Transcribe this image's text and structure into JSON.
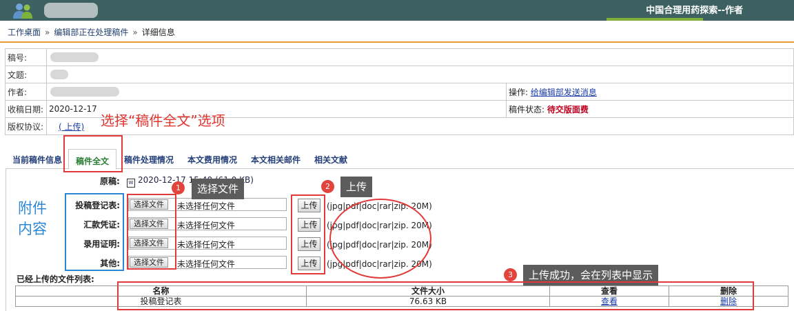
{
  "header": {
    "system_title": "中国合理用药探索--作者"
  },
  "breadcrumb": {
    "items": [
      "工作桌面",
      "编辑部正在处理稿件",
      "详细信息"
    ],
    "separator": "»"
  },
  "info": {
    "manuscript_no_label": "稿号:",
    "title_label": "文题:",
    "author_label": "作者:",
    "received_label": "收稿日期:",
    "received_value": "2020-12-17",
    "copyright_label": "版权协议:",
    "copyright_link": "( 上传)",
    "operation_label": "操作:",
    "operation_link": "给编辑部发送消息",
    "status_label": "稿件状态:",
    "status_value": "待交版面费"
  },
  "tabs": [
    "当前稿件信息",
    "稿件全文",
    "稿件处理情况",
    "本文费用情况",
    "本文相关邮件",
    "相关文献"
  ],
  "active_tab": "稿件全文",
  "original": {
    "label": "原稿:",
    "file": "2020-12-17 15:40 (61.0 KB)"
  },
  "attachments": {
    "choose_label": "选择文件",
    "none_label": "未选择任何文件",
    "upload_label": "上传",
    "format_hint": "(jpg|pdf|doc|rar|zip.  20M)",
    "rows": [
      "投稿登记表:",
      "汇款凭证:",
      "录用证明:",
      "其他:"
    ]
  },
  "uploaded": {
    "title": "已经上传的文件列表:",
    "headers": [
      "名称",
      "文件大小",
      "查看",
      "删除"
    ],
    "rows": [
      {
        "name": "投稿登记表",
        "size": "76.63 KB",
        "view": "查看",
        "delete": "删除"
      }
    ]
  },
  "annotations": {
    "select_tab_note": "选择“稿件全文”选项",
    "attachments_note_1": "附件",
    "attachments_note_2": "内容",
    "step1_num": "1",
    "step1_text": "选择文件",
    "step2_num": "2",
    "step2_text": "上传",
    "step3_num": "3",
    "step3_text": "上传成功，会在列表中显示"
  },
  "colors": {
    "banner": "#3d6163",
    "accent_orange": "#e99b2e",
    "annotation_red": "#e03a3a",
    "annotation_blue": "#2b86d6",
    "status_red": "#c0001d"
  }
}
